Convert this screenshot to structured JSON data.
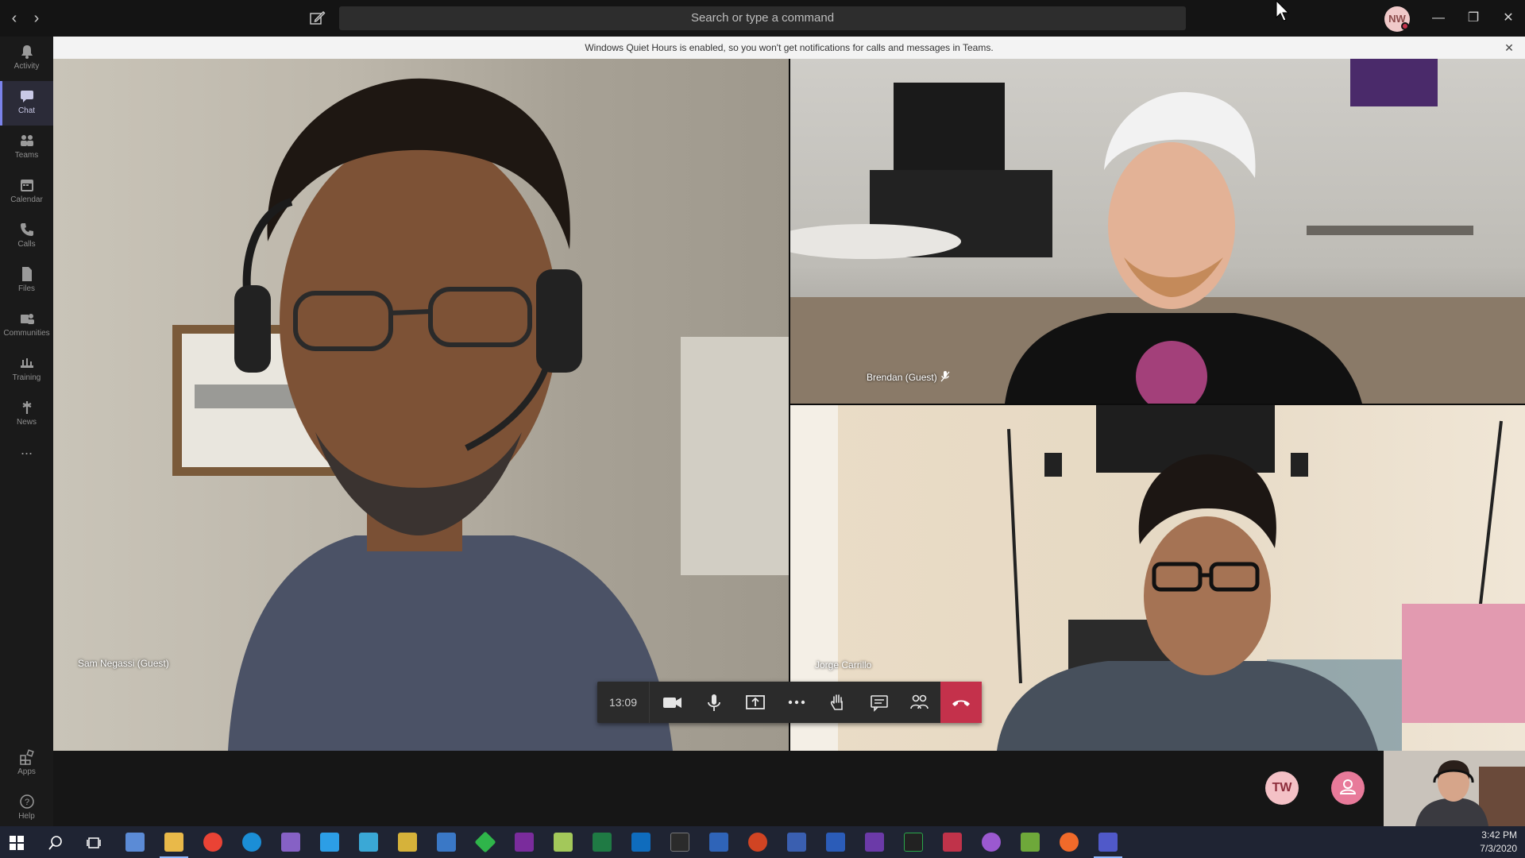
{
  "titlebar": {
    "search_placeholder": "Search or type a command",
    "avatar_initials": "NW"
  },
  "rail": {
    "items": [
      {
        "label": "Activity",
        "icon": "bell-icon"
      },
      {
        "label": "Chat",
        "icon": "chat-icon",
        "active": true
      },
      {
        "label": "Teams",
        "icon": "teams-icon"
      },
      {
        "label": "Calendar",
        "icon": "calendar-icon"
      },
      {
        "label": "Calls",
        "icon": "phone-icon"
      },
      {
        "label": "Files",
        "icon": "file-icon"
      },
      {
        "label": "Communities",
        "icon": "communities-icon"
      },
      {
        "label": "Training",
        "icon": "training-icon"
      },
      {
        "label": "News",
        "icon": "news-icon"
      }
    ],
    "more": "...",
    "bottom": [
      {
        "label": "Apps",
        "icon": "apps-icon"
      },
      {
        "label": "Help",
        "icon": "help-icon"
      }
    ]
  },
  "banner": {
    "text": "Windows Quiet Hours is enabled, so you won't get notifications for calls and messages in Teams."
  },
  "participants": [
    {
      "name": "Sam Negassi (Guest)"
    },
    {
      "name": "Brendan (Guest)",
      "muted": true
    },
    {
      "name": "Jorge Carrillo"
    }
  ],
  "controls": {
    "timer": "13:09",
    "buttons": [
      "camera-icon",
      "microphone-icon",
      "share-screen-icon",
      "more-options-icon",
      "raise-hand-icon",
      "chat-icon",
      "participants-icon",
      "hang-up-icon"
    ]
  },
  "bottom": {
    "tw_initials": "TW"
  },
  "taskbar": {
    "time": "3:42 PM",
    "date": "7/3/2020"
  },
  "colors": {
    "accent": "#7b83eb",
    "hangup": "#c4314b",
    "banner_bg": "#f3f3f3"
  }
}
